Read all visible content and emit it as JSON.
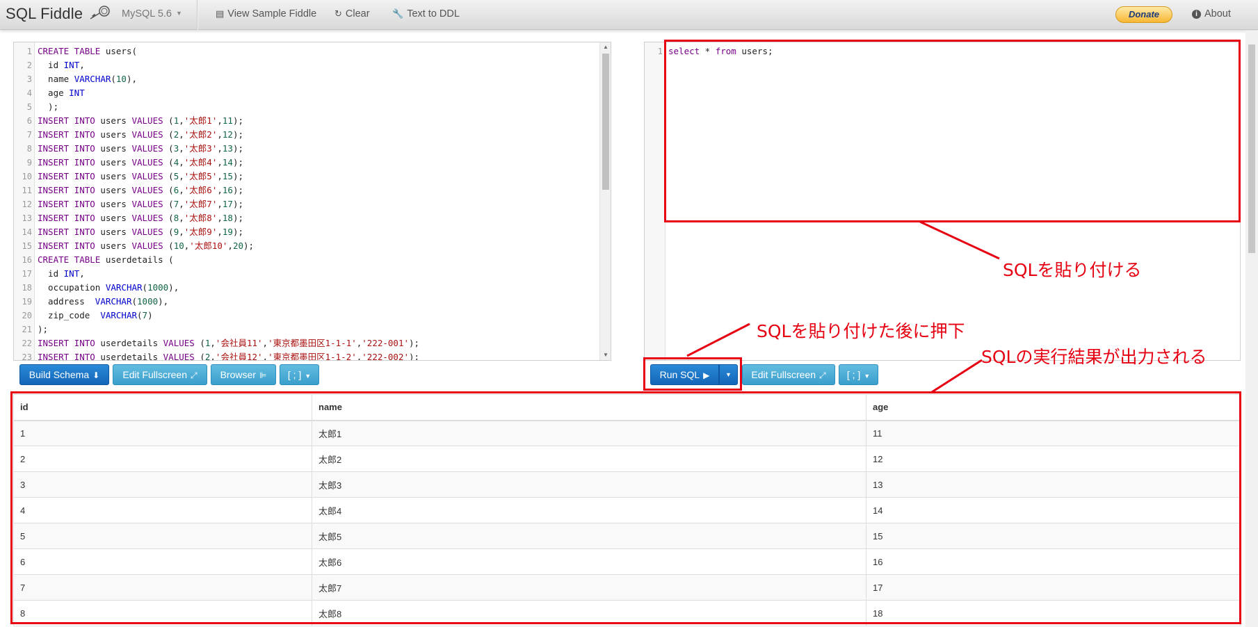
{
  "navbar": {
    "brand": "SQL Fiddle",
    "db_select": "MySQL 5.6",
    "view_sample": "View Sample Fiddle",
    "clear": "Clear",
    "text_to_ddl": "Text to DDL",
    "donate": "Donate",
    "about": "About"
  },
  "schema_editor": {
    "lines": [
      [
        [
          "kw",
          "CREATE TABLE"
        ],
        [
          "tx",
          " users("
        ]
      ],
      [
        [
          "tx",
          "  id "
        ],
        [
          "ty",
          "INT"
        ],
        [
          "tx",
          ","
        ]
      ],
      [
        [
          "tx",
          "  name "
        ],
        [
          "ty",
          "VARCHAR"
        ],
        [
          "tx",
          "("
        ],
        [
          "nm",
          "10"
        ],
        [
          "tx",
          "),"
        ]
      ],
      [
        [
          "tx",
          "  age "
        ],
        [
          "ty",
          "INT"
        ]
      ],
      [
        [
          "tx",
          "  );"
        ]
      ],
      [
        [
          "kw",
          "INSERT INTO"
        ],
        [
          "tx",
          " users "
        ],
        [
          "kw",
          "VALUES"
        ],
        [
          "tx",
          " ("
        ],
        [
          "nm",
          "1"
        ],
        [
          "tx",
          ","
        ],
        [
          "st",
          "'太郎1'"
        ],
        [
          "tx",
          ","
        ],
        [
          "nm",
          "11"
        ],
        [
          "tx",
          ");"
        ]
      ],
      [
        [
          "kw",
          "INSERT INTO"
        ],
        [
          "tx",
          " users "
        ],
        [
          "kw",
          "VALUES"
        ],
        [
          "tx",
          " ("
        ],
        [
          "nm",
          "2"
        ],
        [
          "tx",
          ","
        ],
        [
          "st",
          "'太郎2'"
        ],
        [
          "tx",
          ","
        ],
        [
          "nm",
          "12"
        ],
        [
          "tx",
          ");"
        ]
      ],
      [
        [
          "kw",
          "INSERT INTO"
        ],
        [
          "tx",
          " users "
        ],
        [
          "kw",
          "VALUES"
        ],
        [
          "tx",
          " ("
        ],
        [
          "nm",
          "3"
        ],
        [
          "tx",
          ","
        ],
        [
          "st",
          "'太郎3'"
        ],
        [
          "tx",
          ","
        ],
        [
          "nm",
          "13"
        ],
        [
          "tx",
          ");"
        ]
      ],
      [
        [
          "kw",
          "INSERT INTO"
        ],
        [
          "tx",
          " users "
        ],
        [
          "kw",
          "VALUES"
        ],
        [
          "tx",
          " ("
        ],
        [
          "nm",
          "4"
        ],
        [
          "tx",
          ","
        ],
        [
          "st",
          "'太郎4'"
        ],
        [
          "tx",
          ","
        ],
        [
          "nm",
          "14"
        ],
        [
          "tx",
          ");"
        ]
      ],
      [
        [
          "kw",
          "INSERT INTO"
        ],
        [
          "tx",
          " users "
        ],
        [
          "kw",
          "VALUES"
        ],
        [
          "tx",
          " ("
        ],
        [
          "nm",
          "5"
        ],
        [
          "tx",
          ","
        ],
        [
          "st",
          "'太郎5'"
        ],
        [
          "tx",
          ","
        ],
        [
          "nm",
          "15"
        ],
        [
          "tx",
          ");"
        ]
      ],
      [
        [
          "kw",
          "INSERT INTO"
        ],
        [
          "tx",
          " users "
        ],
        [
          "kw",
          "VALUES"
        ],
        [
          "tx",
          " ("
        ],
        [
          "nm",
          "6"
        ],
        [
          "tx",
          ","
        ],
        [
          "st",
          "'太郎6'"
        ],
        [
          "tx",
          ","
        ],
        [
          "nm",
          "16"
        ],
        [
          "tx",
          ");"
        ]
      ],
      [
        [
          "kw",
          "INSERT INTO"
        ],
        [
          "tx",
          " users "
        ],
        [
          "kw",
          "VALUES"
        ],
        [
          "tx",
          " ("
        ],
        [
          "nm",
          "7"
        ],
        [
          "tx",
          ","
        ],
        [
          "st",
          "'太郎7'"
        ],
        [
          "tx",
          ","
        ],
        [
          "nm",
          "17"
        ],
        [
          "tx",
          ");"
        ]
      ],
      [
        [
          "kw",
          "INSERT INTO"
        ],
        [
          "tx",
          " users "
        ],
        [
          "kw",
          "VALUES"
        ],
        [
          "tx",
          " ("
        ],
        [
          "nm",
          "8"
        ],
        [
          "tx",
          ","
        ],
        [
          "st",
          "'太郎8'"
        ],
        [
          "tx",
          ","
        ],
        [
          "nm",
          "18"
        ],
        [
          "tx",
          ");"
        ]
      ],
      [
        [
          "kw",
          "INSERT INTO"
        ],
        [
          "tx",
          " users "
        ],
        [
          "kw",
          "VALUES"
        ],
        [
          "tx",
          " ("
        ],
        [
          "nm",
          "9"
        ],
        [
          "tx",
          ","
        ],
        [
          "st",
          "'太郎9'"
        ],
        [
          "tx",
          ","
        ],
        [
          "nm",
          "19"
        ],
        [
          "tx",
          ");"
        ]
      ],
      [
        [
          "kw",
          "INSERT INTO"
        ],
        [
          "tx",
          " users "
        ],
        [
          "kw",
          "VALUES"
        ],
        [
          "tx",
          " ("
        ],
        [
          "nm",
          "10"
        ],
        [
          "tx",
          ","
        ],
        [
          "st",
          "'太郎10'"
        ],
        [
          "tx",
          ","
        ],
        [
          "nm",
          "20"
        ],
        [
          "tx",
          ");"
        ]
      ],
      [
        [
          "kw",
          "CREATE TABLE"
        ],
        [
          "tx",
          " userdetails ("
        ]
      ],
      [
        [
          "tx",
          "  id "
        ],
        [
          "ty",
          "INT"
        ],
        [
          "tx",
          ","
        ]
      ],
      [
        [
          "tx",
          "  occupation "
        ],
        [
          "ty",
          "VARCHAR"
        ],
        [
          "tx",
          "("
        ],
        [
          "nm",
          "1000"
        ],
        [
          "tx",
          "),"
        ]
      ],
      [
        [
          "tx",
          "  address  "
        ],
        [
          "ty",
          "VARCHAR"
        ],
        [
          "tx",
          "("
        ],
        [
          "nm",
          "1000"
        ],
        [
          "tx",
          "),"
        ]
      ],
      [
        [
          "tx",
          "  zip_code  "
        ],
        [
          "ty",
          "VARCHAR"
        ],
        [
          "tx",
          "("
        ],
        [
          "nm",
          "7"
        ],
        [
          "tx",
          ")"
        ]
      ],
      [
        [
          "tx",
          ");"
        ]
      ],
      [
        [
          "kw",
          "INSERT INTO"
        ],
        [
          "tx",
          " userdetails "
        ],
        [
          "kw",
          "VALUES"
        ],
        [
          "tx",
          " ("
        ],
        [
          "nm",
          "1"
        ],
        [
          "tx",
          ","
        ],
        [
          "st",
          "'会社員11'"
        ],
        [
          "tx",
          ","
        ],
        [
          "st",
          "'東京都墨田区1-1-1'"
        ],
        [
          "tx",
          ","
        ],
        [
          "st",
          "'222-001'"
        ],
        [
          "tx",
          ");"
        ]
      ],
      [
        [
          "kw",
          "INSERT INTO"
        ],
        [
          "tx",
          " userdetails "
        ],
        [
          "kw",
          "VALUES"
        ],
        [
          "tx",
          " ("
        ],
        [
          "nm",
          "2"
        ],
        [
          "tx",
          ","
        ],
        [
          "st",
          "'会社員12'"
        ],
        [
          "tx",
          ","
        ],
        [
          "st",
          "'東京都墨田区1-1-2'"
        ],
        [
          "tx",
          ","
        ],
        [
          "st",
          "'222-002'"
        ],
        [
          "tx",
          ");"
        ]
      ]
    ]
  },
  "query_editor": {
    "lines": [
      [
        [
          "kw",
          "select"
        ],
        [
          "tx",
          " * "
        ],
        [
          "kw",
          "from"
        ],
        [
          "tx",
          " users;"
        ]
      ]
    ]
  },
  "schema_buttons": {
    "build": "Build Schema",
    "edit_fullscreen": "Edit Fullscreen",
    "browser": "Browser",
    "delimiter": "[ ; ]"
  },
  "query_buttons": {
    "run": "Run SQL",
    "edit_fullscreen": "Edit Fullscreen",
    "delimiter": "[ ; ]"
  },
  "results": {
    "columns": [
      "id",
      "name",
      "age"
    ],
    "rows": [
      [
        "1",
        "太郎1",
        "11"
      ],
      [
        "2",
        "太郎2",
        "12"
      ],
      [
        "3",
        "太郎3",
        "13"
      ],
      [
        "4",
        "太郎4",
        "14"
      ],
      [
        "5",
        "太郎5",
        "15"
      ],
      [
        "6",
        "太郎6",
        "16"
      ],
      [
        "7",
        "太郎7",
        "17"
      ],
      [
        "8",
        "太郎8",
        "18"
      ]
    ]
  },
  "annotations": {
    "paste_sql": "SQLを貼り付ける",
    "press_after_paste": "SQLを貼り付けた後に押下",
    "result_output": "SQLの実行結果が出力される"
  },
  "colors": {
    "annotation_red": "#e60012",
    "primary_blue": "#1465b8",
    "info_blue": "#3a9fcc"
  }
}
